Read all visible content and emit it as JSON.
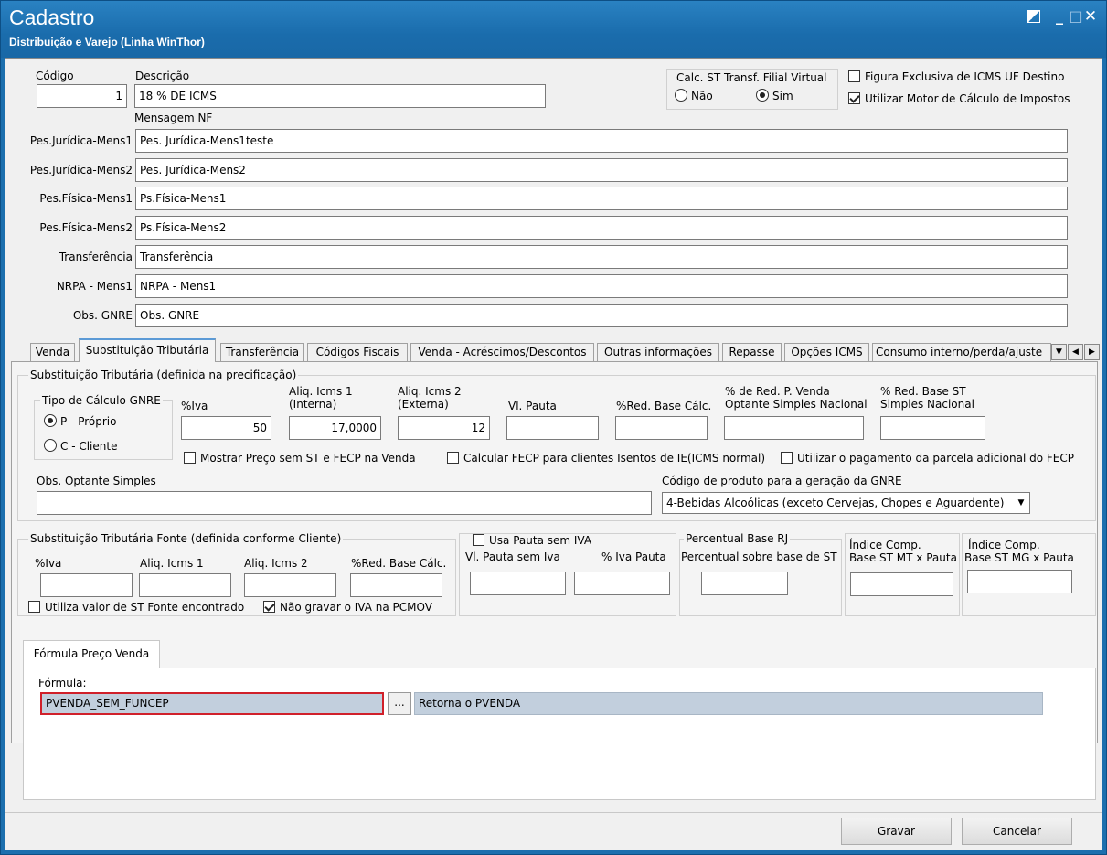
{
  "window": {
    "title": "Cadastro",
    "subtitle": "Distribuição e Varejo (Linha WinThor)",
    "restore_icon": "restore-icon",
    "minimize": "_",
    "maximize": "□",
    "close": "✕"
  },
  "header": {
    "codigo_label": "Código",
    "codigo_value": "1",
    "descricao_label": "Descrição",
    "descricao_value": "18 % DE ICMS",
    "calc_st_label": "Calc. ST Transf. Filial Virtual",
    "nao_label": "Não",
    "sim_label": "Sim",
    "calc_st_selected": "Sim",
    "figura_label": "Figura Exclusiva de ICMS UF Destino",
    "figura_checked": false,
    "motor_label": "Utilizar Motor de Cálculo de Impostos",
    "motor_checked": true,
    "mensagem_nf_label": "Mensagem NF"
  },
  "messages": [
    {
      "label": "Pes.Jurídica-Mens1",
      "value": "Pes. Jurídica-Mens1teste"
    },
    {
      "label": "Pes.Jurídica-Mens2",
      "value": "Pes. Jurídica-Mens2"
    },
    {
      "label": "Pes.Física-Mens1",
      "value": "Ps.Física-Mens1"
    },
    {
      "label": "Pes.Física-Mens2",
      "value": "Ps.Física-Mens2"
    },
    {
      "label": "Transferência",
      "value": "Transferência"
    },
    {
      "label": "NRPA - Mens1",
      "value": "NRPA - Mens1"
    },
    {
      "label": "Obs. GNRE",
      "value": "Obs. GNRE"
    }
  ],
  "tabs": [
    "Venda",
    "Substituição Tributária",
    "Transferência",
    "Códigos Fiscais",
    "Venda - Acréscimos/Descontos",
    "Outras informações",
    "Repasse",
    "Opções ICMS",
    "Consumo interno/perda/ajuste"
  ],
  "active_tab": "Substituição Tributária",
  "st": {
    "group_title": "Substituição Tributária (definida na precificação)",
    "gnre_title": "Tipo de Cálculo GNRE",
    "gnre_p": "P - Próprio",
    "gnre_c": "C - Cliente",
    "gnre_selected": "P",
    "iva_label": "%Iva",
    "iva_value": "50",
    "aliq1_label": "Aliq. Icms 1\n(Interna)",
    "aliq1_l1": "Aliq. Icms 1",
    "aliq1_l2": "(Interna)",
    "aliq1_value": "17,0000",
    "aliq2_l1": "Aliq. Icms 2",
    "aliq2_l2": "(Externa)",
    "aliq2_value": "12",
    "vl_pauta_label": "Vl. Pauta",
    "vl_pauta_value": "",
    "red_base_label": "%Red. Base Cálc.",
    "red_base_value": "",
    "red_pvenda_l1": "% de Red. P. Venda",
    "red_pvenda_l2": "Optante Simples Nacional",
    "red_pvenda_value": "",
    "red_base_st_l1": "% Red. Base ST",
    "red_base_st_l2": "Simples Nacional",
    "red_base_st_value": "",
    "mostrar_preco_label": "Mostrar Preço sem ST e FECP na Venda",
    "mostrar_preco_checked": false,
    "calc_fecp_label": "Calcular FECP para clientes Isentos de IE(ICMS normal)",
    "calc_fecp_checked": false,
    "pag_parcela_label": "Utilizar o pagamento da parcela adicional do FECP",
    "pag_parcela_checked": false,
    "obs_optante_label": "Obs. Optante Simples",
    "obs_optante_value": "",
    "cod_produto_label": "Código de produto para a geração da GNRE",
    "cod_produto_value": "4-Bebidas Alcoólicas (exceto Cervejas, Chopes e Aguardente)"
  },
  "st_fonte": {
    "group_title": "Substituição Tributária Fonte (definida conforme Cliente)",
    "iva_label": "%Iva",
    "aliq1_label": "Aliq. Icms 1",
    "aliq2_label": "Aliq. Icms 2",
    "red_label": "%Red. Base Cálc.",
    "utiliza_label": "Utiliza valor de ST Fonte encontrado",
    "utiliza_checked": false,
    "nao_gravar_label": "Não gravar o IVA na PCMOV",
    "nao_gravar_checked": true
  },
  "pauta": {
    "usa_label": "Usa Pauta sem IVA",
    "usa_checked": false,
    "vl_label": "Vl. Pauta sem Iva",
    "iva_label": "% Iva Pauta"
  },
  "rj": {
    "title": "Percentual Base RJ",
    "label": "Percentual sobre base de ST"
  },
  "indice_mt": {
    "l1": "Índice Comp.",
    "l2": "Base ST MT x Pauta"
  },
  "indice_mg": {
    "l1": "Índice Comp.",
    "l2": "Base ST MG x Pauta"
  },
  "formula": {
    "tab_label": "Fórmula Preço Venda",
    "label": "Fórmula:",
    "value": "PVENDA_SEM_FUNCEP",
    "browse": "...",
    "description": "Retorna o PVENDA"
  },
  "buttons": {
    "gravar": "Gravar",
    "cancelar": "Cancelar"
  }
}
